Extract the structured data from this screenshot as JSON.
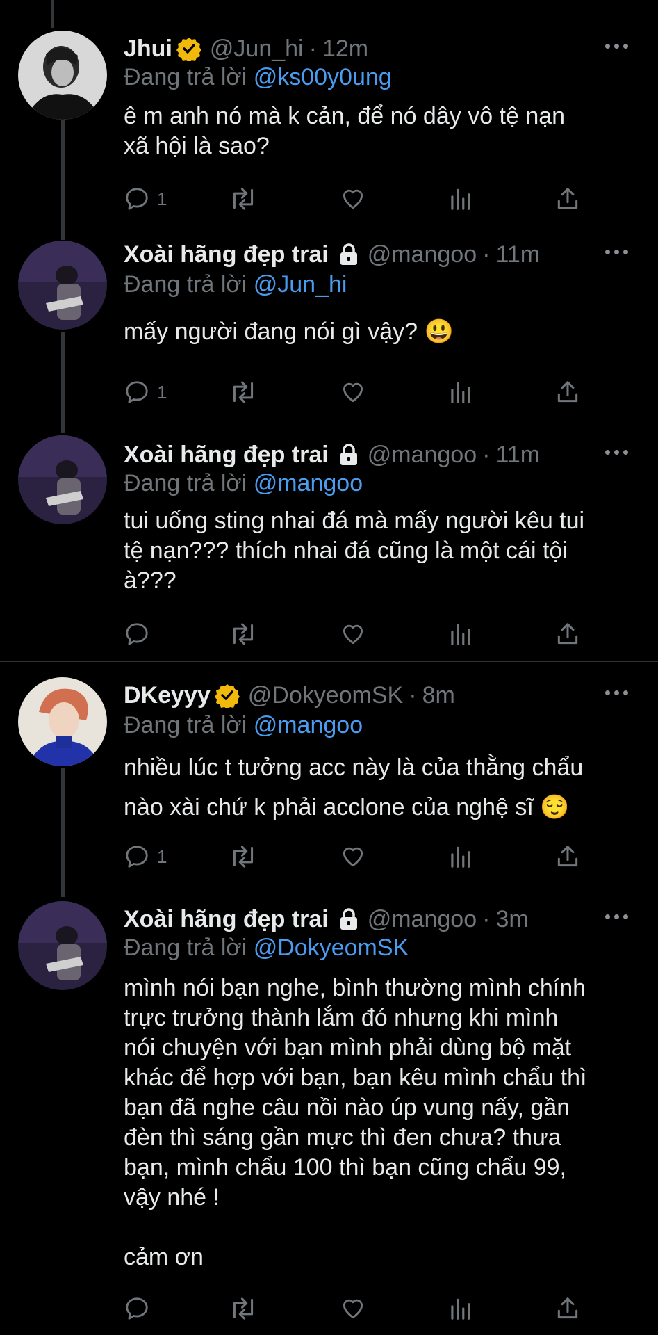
{
  "reply_prefix": "Đang trả lời",
  "tweets": [
    {
      "name": "Jhui",
      "verified": true,
      "locked": false,
      "handle": "@Jun_hi",
      "time": "12m",
      "reply_to": "@ks00y0ung",
      "text": "ê m anh nó mà k cản, để nó dây vô tệ nạn\nxã hội là sao?",
      "reply_count": "1"
    },
    {
      "name": "Xoài hãng đẹp trai",
      "verified": false,
      "locked": true,
      "handle": "@mangoo",
      "time": "11m",
      "reply_to": "@Jun_hi",
      "text": "mấy người đang nói gì vậy? 😃",
      "reply_count": "1"
    },
    {
      "name": "Xoài hãng đẹp trai",
      "verified": false,
      "locked": true,
      "handle": "@mangoo",
      "time": "11m",
      "reply_to": "@mangoo",
      "text": "tui uống sting nhai đá mà mấy người kêu tui\ntệ nạn??? thích nhai đá cũng là một cái tội\nà???",
      "reply_count": ""
    },
    {
      "name": "DKeyyy",
      "verified": true,
      "locked": false,
      "handle": "@DokyeomSK",
      "time": "8m",
      "reply_to": "@mangoo",
      "text": "nhiều lúc t tưởng acc này là của thằng chẩu\nnào xài chứ k phải acclone của nghệ sĩ 😌",
      "reply_count": "1"
    },
    {
      "name": "Xoài hãng đẹp trai",
      "verified": false,
      "locked": true,
      "handle": "@mangoo",
      "time": "3m",
      "reply_to": "@DokyeomSK",
      "text": "mình nói bạn nghe, bình thường mình chính\ntrực trưởng thành lắm đó nhưng khi mình\nnói chuyện với bạn mình phải dùng bộ mặt\nkhác để hợp với bạn, bạn kêu mình chẩu thì\nbạn đã nghe câu nồi nào úp vung nấy, gần\nđèn thì sáng gần mực thì đen chưa? thưa\nbạn, mình chẩu 100 thì bạn cũng chẩu 99,\nvậy nhé !\n\ncảm ơn",
      "reply_count": ""
    }
  ],
  "colors": {
    "background": "#000000",
    "text": "#e7e9ea",
    "secondary": "#71767b",
    "link": "#4a9cf0",
    "verified": "#f0b90b"
  },
  "icons": {
    "reply": "comment-bubble-icon",
    "retweet": "retweet-icon",
    "like": "heart-icon",
    "views": "bar-chart-icon",
    "share": "share-icon",
    "more": "more-dots-icon",
    "verified": "verified-badge-icon",
    "locked": "lock-icon"
  }
}
